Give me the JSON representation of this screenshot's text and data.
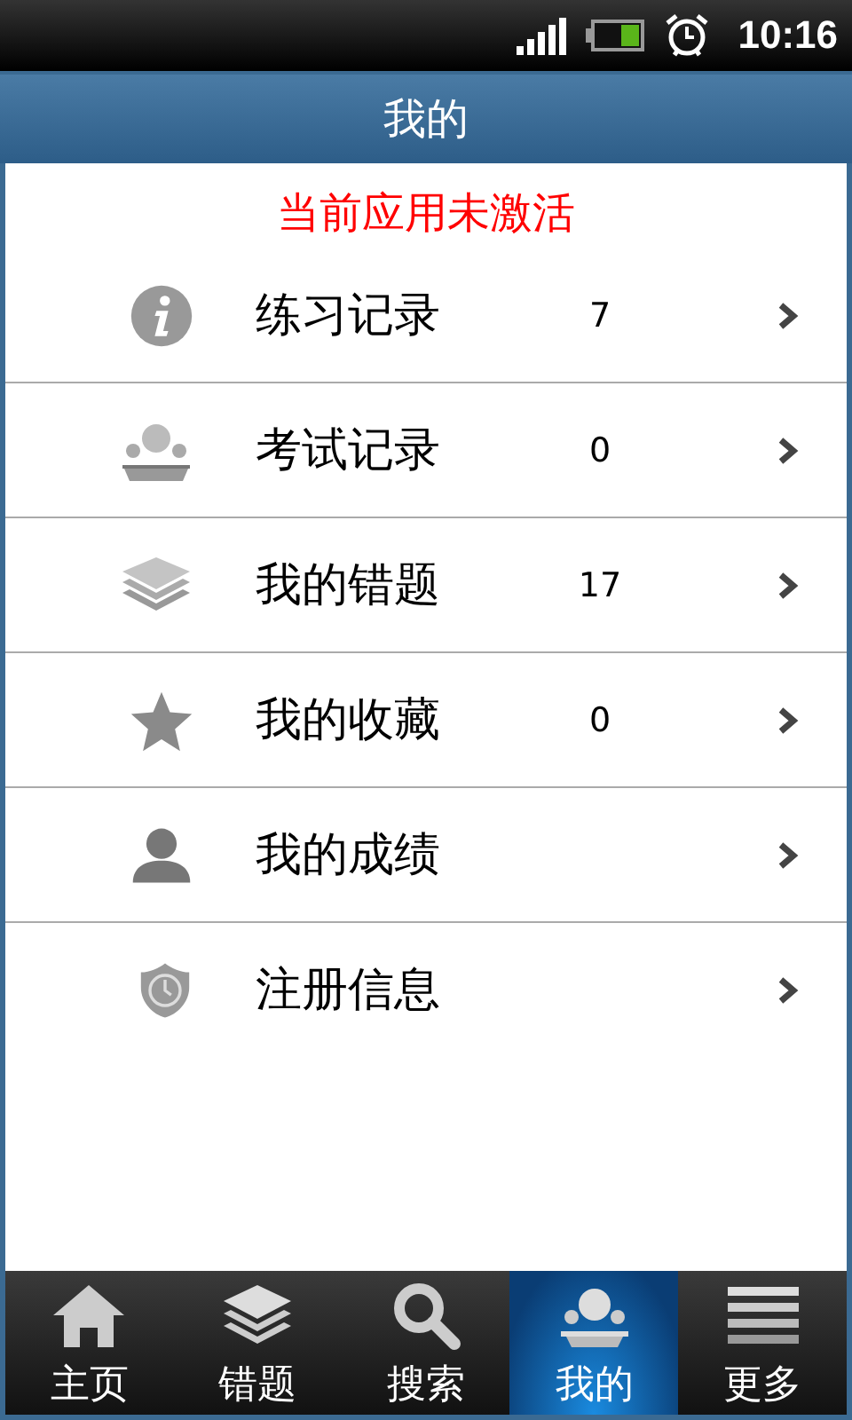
{
  "status_bar": {
    "time": "10:16"
  },
  "title": "我的",
  "notice": "当前应用未激活",
  "items": [
    {
      "label": "练习记录",
      "count": "7"
    },
    {
      "label": "考试记录",
      "count": "0"
    },
    {
      "label": "我的错题",
      "count": "17"
    },
    {
      "label": "我的收藏",
      "count": "0"
    },
    {
      "label": "我的成绩"
    },
    {
      "label": "注册信息"
    }
  ],
  "tabs": [
    {
      "label": "主页",
      "selected": false
    },
    {
      "label": "错题",
      "selected": false
    },
    {
      "label": "搜索",
      "selected": false
    },
    {
      "label": "我的",
      "selected": true
    },
    {
      "label": "更多",
      "selected": false
    }
  ]
}
